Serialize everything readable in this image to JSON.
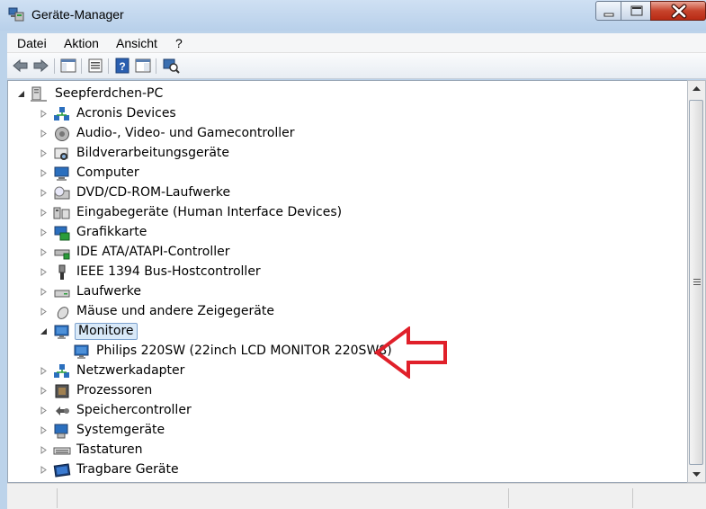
{
  "window": {
    "title": "Geräte-Manager"
  },
  "menu": {
    "items": [
      "Datei",
      "Aktion",
      "Ansicht",
      "?"
    ]
  },
  "toolbar": {
    "buttons": [
      "back-icon",
      "forward-icon",
      "show-hide-console-icon",
      "properties-icon",
      "help-icon",
      "view-icon",
      "scan-hardware-icon"
    ]
  },
  "tree": {
    "root": "Seepferdchen-PC",
    "categories": [
      {
        "label": "Acronis Devices",
        "icon": "network-icon"
      },
      {
        "label": "Audio-, Video- und Gamecontroller",
        "icon": "speaker-icon"
      },
      {
        "label": "Bildverarbeitungsgeräte",
        "icon": "camera-icon"
      },
      {
        "label": "Computer",
        "icon": "computer-icon"
      },
      {
        "label": "DVD/CD-ROM-Laufwerke",
        "icon": "dvd-drive-icon"
      },
      {
        "label": "Eingabegeräte (Human Interface Devices)",
        "icon": "hid-icon"
      },
      {
        "label": "Grafikkarte",
        "icon": "display-adapter-icon"
      },
      {
        "label": "IDE ATA/ATAPI-Controller",
        "icon": "ide-controller-icon"
      },
      {
        "label": "IEEE 1394 Bus-Hostcontroller",
        "icon": "firewire-icon"
      },
      {
        "label": "Laufwerke",
        "icon": "disk-drive-icon"
      },
      {
        "label": "Mäuse und andere Zeigegeräte",
        "icon": "mouse-icon"
      },
      {
        "label": "Monitore",
        "icon": "monitor-icon",
        "expanded": true,
        "selected": true
      },
      {
        "label": "Philips 220SW (22inch LCD MONITOR 220SW8)",
        "icon": "monitor-icon",
        "child": true
      },
      {
        "label": "Netzwerkadapter",
        "icon": "network-adapter-icon"
      },
      {
        "label": "Prozessoren",
        "icon": "processor-icon"
      },
      {
        "label": "Speichercontroller",
        "icon": "storage-controller-icon"
      },
      {
        "label": "Systemgeräte",
        "icon": "system-device-icon"
      },
      {
        "label": "Tastaturen",
        "icon": "keyboard-icon"
      },
      {
        "label": "Tragbare Geräte",
        "icon": "portable-device-icon"
      }
    ]
  },
  "annotation": {
    "color": "#e0202a"
  },
  "colors": {
    "selection": "#d9e9f8",
    "selection_border": "#7da2ce"
  }
}
